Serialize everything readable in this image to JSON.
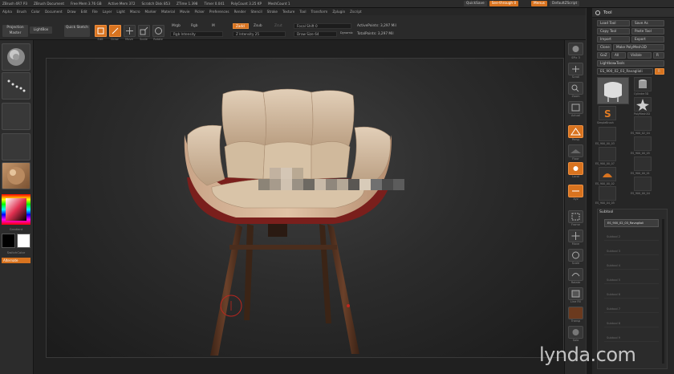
{
  "titlebar": {
    "app": "ZBrush 4R7 P3",
    "items": [
      "ZBrush Document",
      "Free Mem 3.76 GB",
      "Active Mem 372",
      "Scratch Disk 853",
      "ZTime 1.398",
      "Timer 0.041",
      "PolyCount 3.25 KP",
      "MeshCount 1"
    ],
    "quicksave": "QuickSave",
    "seethrough": "See-through 0",
    "menus": "Menus",
    "default_script": "DefaultZScript"
  },
  "menubar": {
    "items": [
      "Alpha",
      "Brush",
      "Color",
      "Document",
      "Draw",
      "Edit",
      "File",
      "Layer",
      "Light",
      "Macro",
      "Marker",
      "Material",
      "Movie",
      "Picker",
      "Preferences",
      "Render",
      "Stencil",
      "Stroke",
      "Texture",
      "Tool",
      "Transform",
      "Zplugin",
      "Zscript"
    ]
  },
  "shelf": {
    "projection_master": "Projection Master",
    "lightbox": "LightBox",
    "quick_sketch": "Quick Sketch",
    "edit": "Edit",
    "draw": "Draw",
    "move": "Move",
    "scale": "Scale",
    "rotate": "Rotate",
    "mrgb": "Mrgb",
    "rgb": "Rgb",
    "m": "M",
    "rgb_intensity": "Rgb Intensity",
    "zadd": "Zadd",
    "zsub": "Zsub",
    "zcut": "Zcut",
    "z_intensity": "Z Intensity 25",
    "focal_shift": "Focal Shift 0",
    "draw_size": "Draw Size 64",
    "dynamic": "Dynamic",
    "active_points": "ActivePoints: 3,297 Mil",
    "total_points": "TotalPoints: 3,297 Mil"
  },
  "leftpanel": {
    "gradient": "Gradient",
    "switch_color": "SwitchColor",
    "alternate": "Alternate"
  },
  "rightshelf": {
    "items": [
      "BPR",
      "SPix 3",
      "Scroll",
      "Zoom",
      "Actual",
      "AAHalf",
      "Persp",
      "Floor",
      "Local",
      "L.Sym",
      "Xyz",
      "Frame",
      "Move",
      "Scale",
      "Rotate",
      "Line Fill",
      "PolyF",
      "Transp",
      "Ghost",
      "Solo",
      "Xpose"
    ]
  },
  "tray": {
    "title": "Tool",
    "load_tool": "Load Tool",
    "save_as": "Save As",
    "copy_tool": "Copy Tool",
    "paste_tool": "Paste Tool",
    "import": "Import",
    "export": "Export",
    "clone": "Clone",
    "make_polymesh": "Make PolyMesh3D",
    "goz": "GoZ",
    "all": "All",
    "visible": "Visible",
    "r": "R",
    "lightbox_tools": "Lightbox▸Tools",
    "current_tool": "ES_900_02_03_Ravaglioli",
    "tools": [
      "Cylinder3D",
      "PolyMesh3D",
      "SimpleBrush",
      "ES_900_02_04",
      "ES_900_00_03",
      "ES_900_00_05",
      "ES_900_00_07",
      "ES_900_00_01",
      "ES_900_00_02",
      "ES_900_00_04",
      "ES_900_04_05"
    ],
    "subtool": "Subtool",
    "subtool_item": "ES_900_02_03_Ravaglioli",
    "subtool_empty": [
      "Subtool 2",
      "Subtool 3",
      "Subtool 4",
      "Subtool 5",
      "Subtool 6",
      "Subtool 7",
      "Subtool 8",
      "Subtool 9"
    ]
  },
  "watermark": "lynda.com",
  "colors": {
    "accent": "#d8731f",
    "panel": "#2c2c2c",
    "canvas": "#2c2c2c"
  }
}
